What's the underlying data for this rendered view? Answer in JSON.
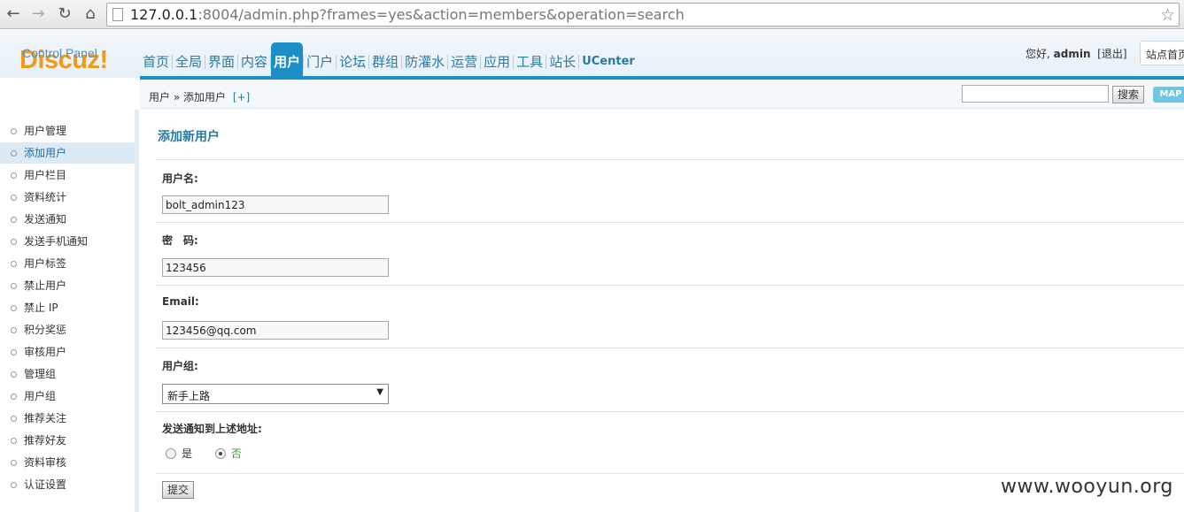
{
  "browser": {
    "url_host": "127.0.0.1",
    "url_rest": ":8004/admin.php?frames=yes&action=members&operation=search"
  },
  "header": {
    "logo": "Discuz!",
    "logo_sub": "Control Panel",
    "nav": [
      "首页",
      "全局",
      "界面",
      "内容",
      "用户",
      "门户",
      "论坛",
      "群组",
      "防灌水",
      "运营",
      "应用",
      "工具",
      "站长",
      "UCenter"
    ],
    "active_nav": "用户",
    "greeting": "您好,",
    "username": "admin",
    "logout": "[退出]",
    "site_home": "站点首页"
  },
  "subbar": {
    "breadcrumb": "用户 » 添加用户",
    "add_shortcut": "[+]",
    "search_button": "搜索",
    "map_button": "MAP"
  },
  "sidebar": {
    "items": [
      "用户管理",
      "添加用户",
      "用户栏目",
      "资料统计",
      "发送通知",
      "发送手机通知",
      "用户标签",
      "禁止用户",
      "禁止 IP",
      "积分奖惩",
      "审核用户",
      "管理组",
      "用户组",
      "推荐关注",
      "推荐好友",
      "资料审核",
      "认证设置"
    ],
    "active": "添加用户"
  },
  "form": {
    "title": "添加新用户",
    "username_label": "用户名:",
    "username_value": "bolt_admin123",
    "password_label": "密　码:",
    "password_value": "123456",
    "email_label": "Email:",
    "email_value": "123456@qq.com",
    "group_label": "用户组:",
    "group_value": "新手上路",
    "notify_label": "发送通知到上述地址:",
    "notify_yes": "是",
    "notify_no": "否",
    "notify_selected": "否",
    "submit": "提交"
  },
  "watermark": "www.wooyun.org"
}
